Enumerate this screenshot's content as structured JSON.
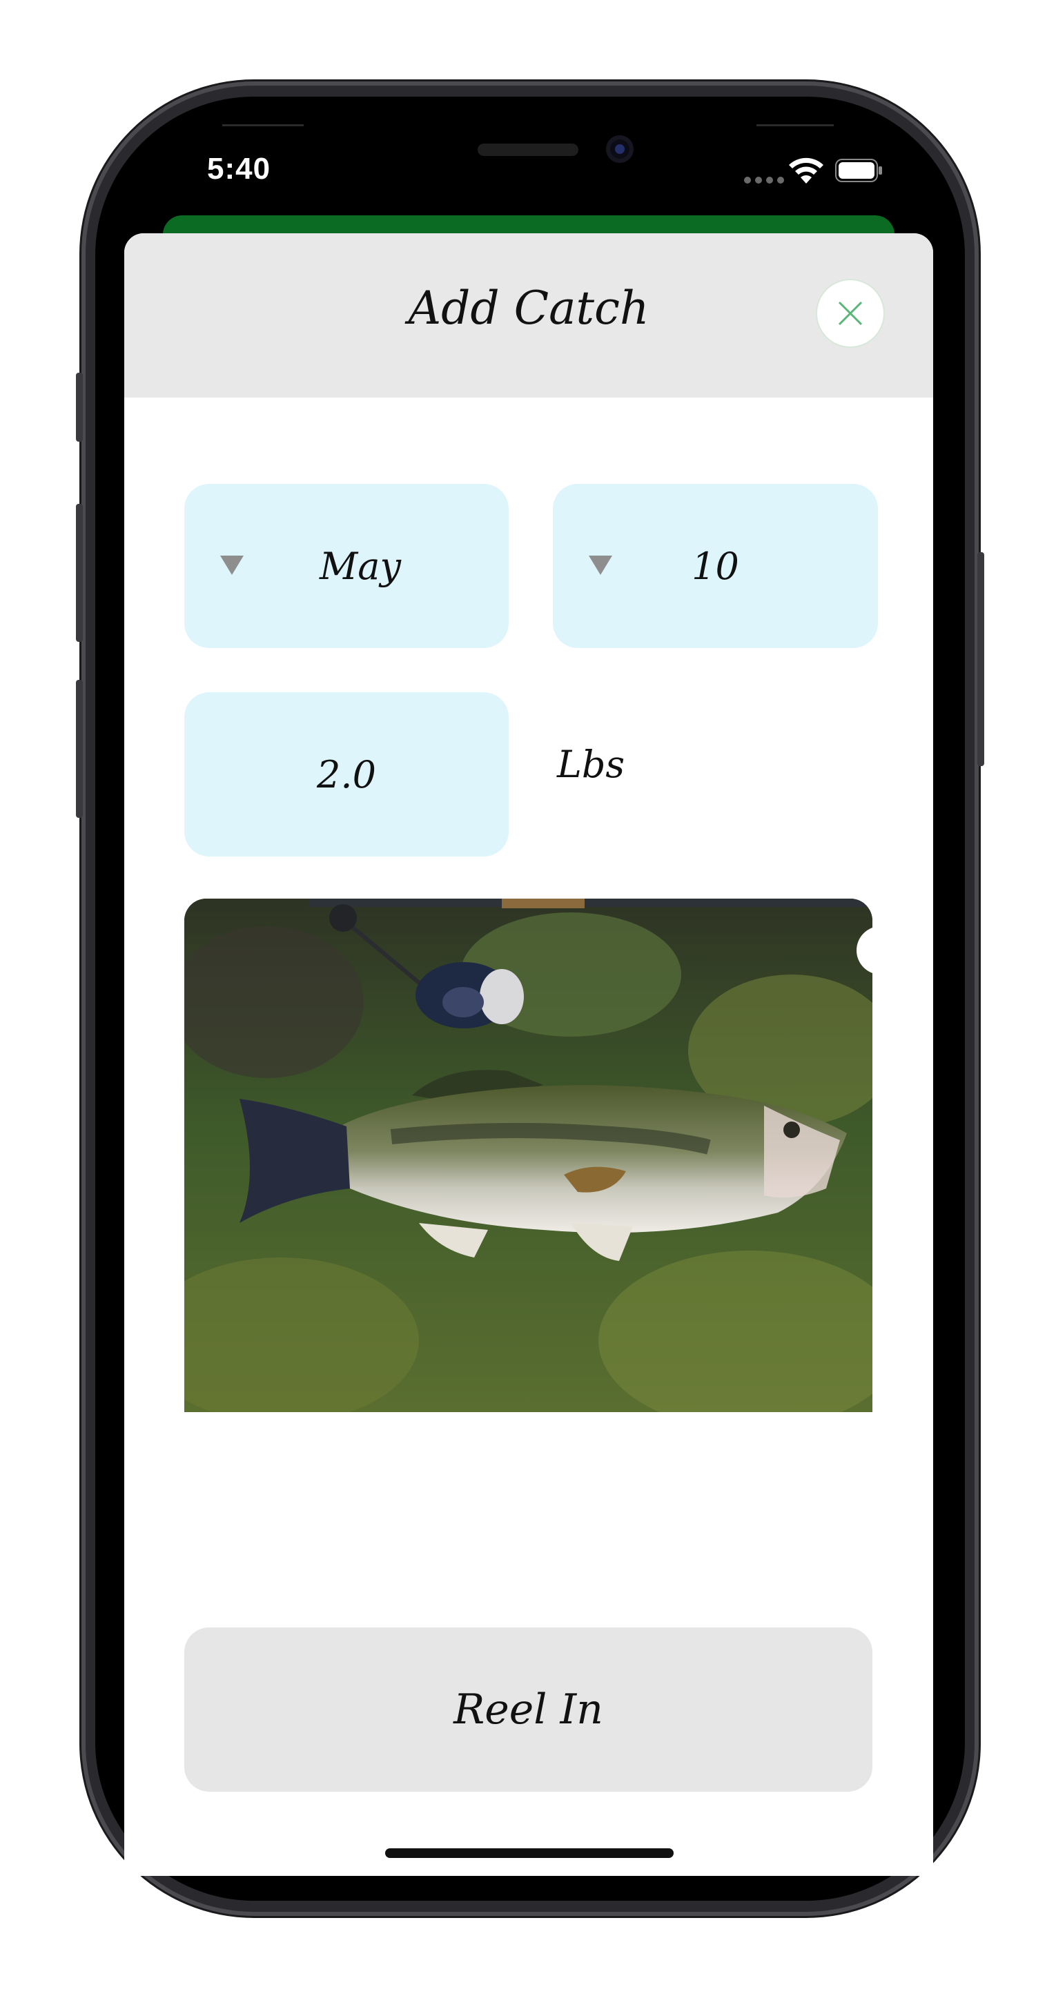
{
  "status_bar": {
    "time": "5:40"
  },
  "sheet": {
    "title": "Add Catch",
    "close_icon": "close-icon"
  },
  "form": {
    "month": {
      "value": "May",
      "icon": "dropdown-caret-icon"
    },
    "day": {
      "value": "10",
      "icon": "dropdown-caret-icon"
    },
    "weight": {
      "value": "2.0",
      "unit": "Lbs"
    }
  },
  "photo": {
    "subject": "largemouth bass",
    "remove_icon": "close-icon"
  },
  "actions": {
    "submit_label": "Reel In"
  },
  "colors": {
    "header_bg": "#e8e8e8",
    "field_bg": "#dff5fc",
    "accent_green": "#0b6b22",
    "close_icon_green": "#5bb577",
    "button_bg": "#e6e6e6"
  }
}
